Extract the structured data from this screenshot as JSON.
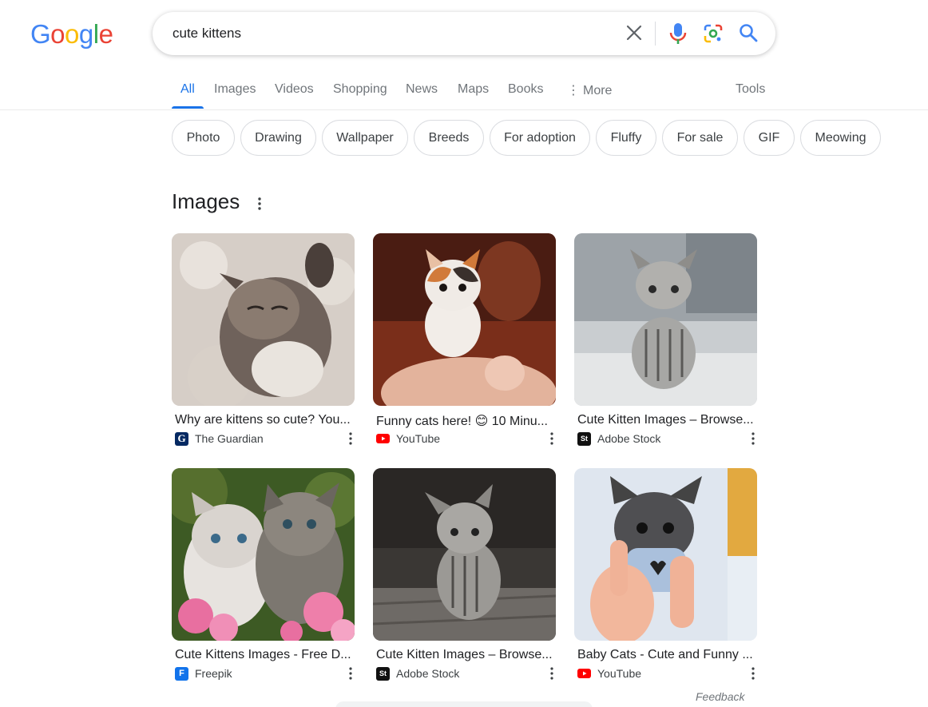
{
  "logo": {
    "letters": [
      "G",
      "o",
      "o",
      "g",
      "l",
      "e"
    ],
    "colors": [
      "#4285F4",
      "#EA4335",
      "#FBBC05",
      "#4285F4",
      "#34A853",
      "#EA4335"
    ]
  },
  "search": {
    "query": "cute kittens"
  },
  "tabs": [
    {
      "label": "All",
      "active": true
    },
    {
      "label": "Images"
    },
    {
      "label": "Videos"
    },
    {
      "label": "Shopping"
    },
    {
      "label": "News"
    },
    {
      "label": "Maps"
    },
    {
      "label": "Books"
    },
    {
      "label": "More"
    }
  ],
  "tools_label": "Tools",
  "chips": [
    "Photo",
    "Drawing",
    "Wallpaper",
    "Breeds",
    "For adoption",
    "Fluffy",
    "For sale",
    "GIF",
    "Meowing"
  ],
  "images_section": {
    "title": "Images"
  },
  "results": [
    {
      "title": "Why are kittens so cute? You...",
      "source": "The Guardian",
      "favicon": "guardian-icon"
    },
    {
      "title": "Funny cats here! 😊 10 Minu...",
      "source": "YouTube",
      "favicon": "youtube-icon"
    },
    {
      "title": "Cute Kitten Images – Browse...",
      "source": "Adobe Stock",
      "favicon": "adobe-stock-icon"
    },
    {
      "title": "Cute Kittens Images - Free D...",
      "source": "Freepik",
      "favicon": "freepik-icon"
    },
    {
      "title": "Cute Kitten Images – Browse...",
      "source": "Adobe Stock",
      "favicon": "adobe-stock-icon"
    },
    {
      "title": "Baby Cats - Cute and Funny ...",
      "source": "YouTube",
      "favicon": "youtube-icon"
    }
  ],
  "feedback": "Feedback",
  "colors": {
    "accent": "#1a73e8",
    "text": "#202124",
    "muted": "#70757a"
  }
}
